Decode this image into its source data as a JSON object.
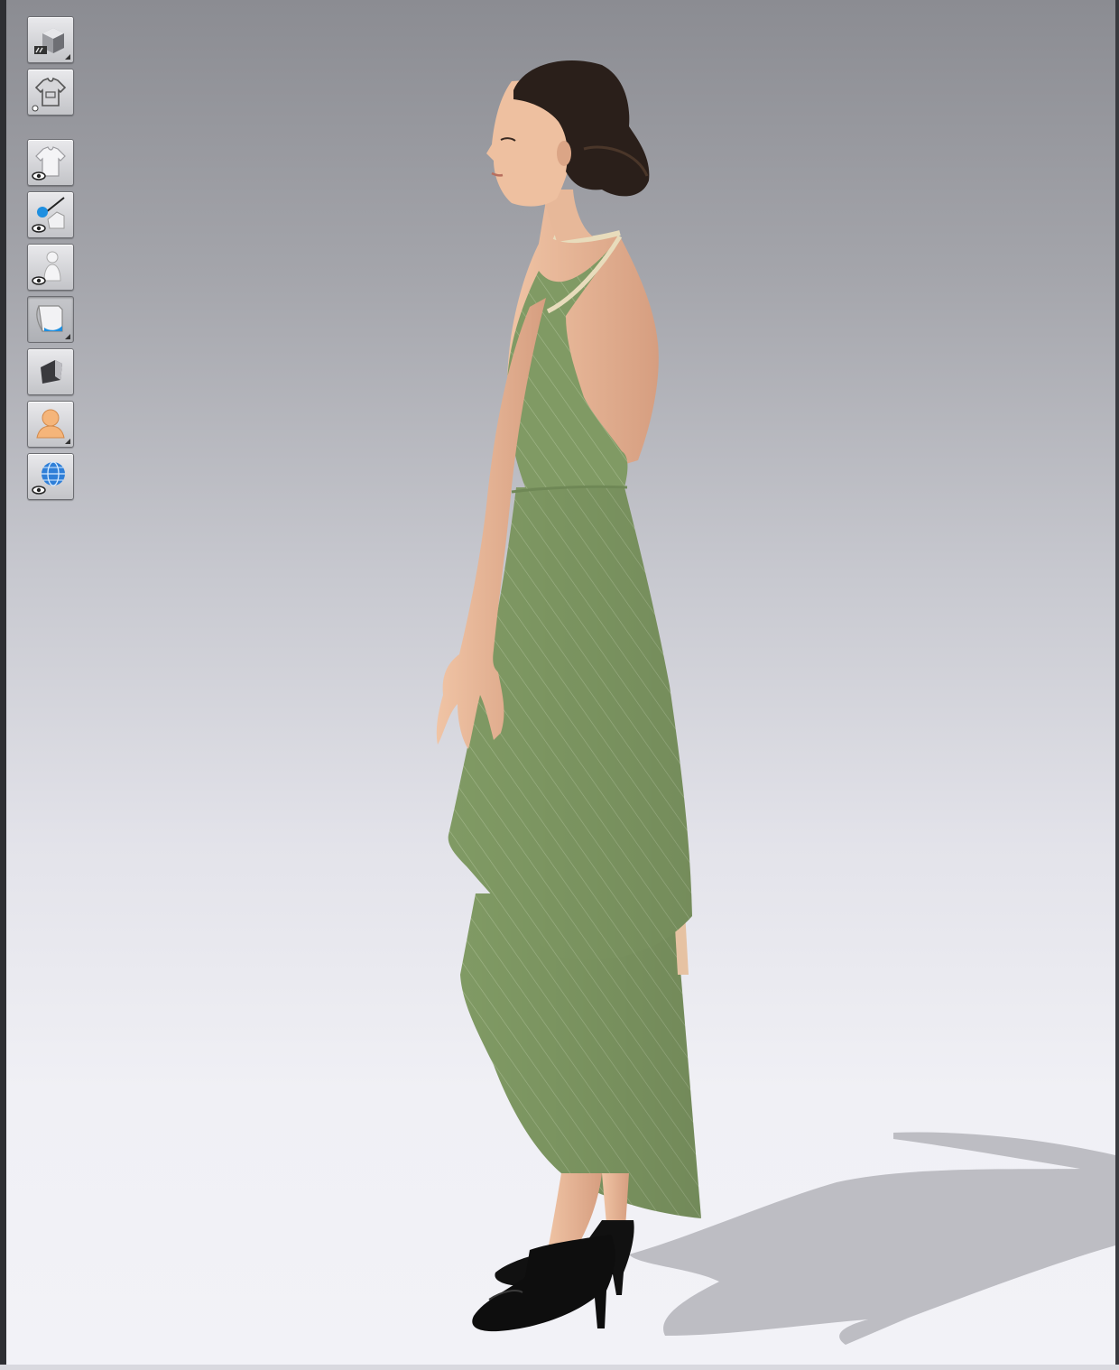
{
  "app": {
    "view": "3d-garment-viewport"
  },
  "toolbar": {
    "buttons": [
      {
        "name": "avatar-display-mode",
        "icon": "cube-display-icon",
        "expandable": true
      },
      {
        "name": "garment-display-mode",
        "icon": "shirt-outline-icon",
        "expandable": false
      },
      {
        "name": "show-garment",
        "icon": "shirt-eye-icon",
        "expandable": false
      },
      {
        "name": "show-pins-measure",
        "icon": "pin-eye-icon",
        "expandable": false
      },
      {
        "name": "show-avatar",
        "icon": "avatar-eye-icon",
        "expandable": false
      },
      {
        "name": "texture-mode",
        "icon": "texture-page-icon",
        "expandable": true
      },
      {
        "name": "solid-mode",
        "icon": "solid-shape-icon",
        "expandable": false
      },
      {
        "name": "avatar-skin",
        "icon": "avatar-bust-icon",
        "expandable": true
      },
      {
        "name": "show-environment",
        "icon": "globe-eye-icon",
        "expandable": false
      }
    ]
  },
  "colors": {
    "background_top": "#8b8c92",
    "background_bottom": "#f2f2f7",
    "dress": "#809a64",
    "skin": "#e8b898",
    "hair": "#2a1f1a",
    "shoes": "#111111",
    "shadow": "#bcbcc2"
  },
  "scene": {
    "avatar": "female-side-profile",
    "garment": "green-halter-hi-low-dress",
    "footwear": "black-peep-toe-heels"
  }
}
